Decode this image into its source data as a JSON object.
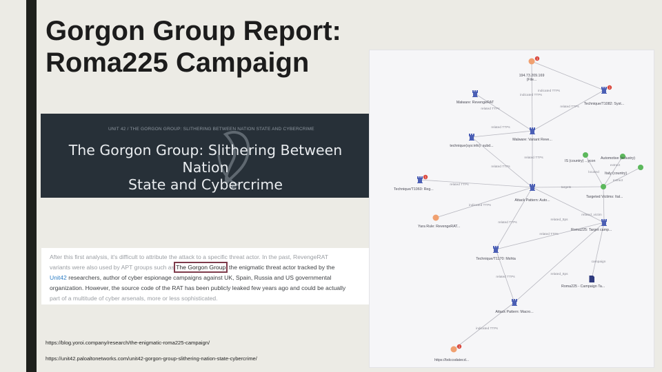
{
  "slide": {
    "title_line1": "Gorgon Group Report:",
    "title_line2": "Roma225 Campaign"
  },
  "banner": {
    "breadcrumb": "UNIT 42 / THE GORGON GROUP: SLITHERING BETWEEN NATION STATE AND CYBERCRIME",
    "title_line1": "The Gorgon Group: Slithering Between Nation",
    "title_line2": "State and Cybercrime"
  },
  "quote": {
    "line1": "After this first analysis, it's difficult to attribute the attack to a specific threat actor. In the past, RevengeRAT",
    "line2a": "variants were also used by APT groups such as",
    "line2_highlight": "The Gorgon Group",
    "line2b": ", the enigmatic threat actor tracked by the",
    "line3_link": "Unit42",
    "line3": " researchers, author of cyber espionage campaigns against UK, Spain, Russia and US governmental",
    "line4": "organization. However, the source code of the RAT has been publicly leaked few years ago and could be actually",
    "line5": "part of a multitude of cyber arsenals, more or less sophisticated."
  },
  "urls": {
    "url1": "https://blog.yoroi.company/research/the-enigmatic-roma225-campaign/",
    "url2": "https://unit42.paloaltonetworks.com/unit42-gorgon-group-slithering-nation-state-cybercrime/"
  },
  "graph": {
    "colors": {
      "edge": "#b8b8c0",
      "pattern": "#4b5fb5",
      "indicator": "#f0a070",
      "identity": "#5cb85c",
      "report": "#2f3b7e",
      "badge": "#d9453a"
    },
    "nodes": [
      {
        "id": "ip",
        "kind": "indicator",
        "label": "194.73.209.169",
        "sub": "(File...",
        "badge": "1"
      },
      {
        "id": "malware",
        "kind": "pattern",
        "label": "Malware: RevengeRAT"
      },
      {
        "id": "tech1082",
        "kind": "pattern",
        "label": "Technique/T1082: Syst...",
        "badge": "1"
      },
      {
        "id": "malvariant",
        "kind": "pattern",
        "label": "Malware: Variant Reve..."
      },
      {
        "id": "techsub",
        "kind": "pattern",
        "label": "technique(sys:info): subd..."
      },
      {
        "id": "ircountry",
        "kind": "identity",
        "label": "IS (country) ...ycon"
      },
      {
        "id": "automotive",
        "kind": "identity",
        "label": "Automotive (industry)"
      },
      {
        "id": "italy",
        "kind": "identity",
        "label": "Italy (country)"
      },
      {
        "id": "tech1060",
        "kind": "pattern",
        "label": "Technique/T1060: Reg...",
        "badge": "1"
      },
      {
        "id": "attackpattern1",
        "kind": "pattern",
        "label": "Attack Pattern: Auto..."
      },
      {
        "id": "targeted",
        "kind": "identity",
        "label": "Targeted Victims: Ital..."
      },
      {
        "id": "yara",
        "kind": "indicator",
        "label": "Yara Rule: RevengeRAT..."
      },
      {
        "id": "roma225",
        "kind": "pattern",
        "label": "Roma225: Target camp..."
      },
      {
        "id": "tech1170",
        "kind": "pattern",
        "label": "Technique/T1170: Mshta"
      },
      {
        "id": "report",
        "kind": "report",
        "label": "Roma225 - Campaign Ta..."
      },
      {
        "id": "attackpattern2",
        "kind": "pattern",
        "label": "Attack Pattern: Macro..."
      },
      {
        "id": "url",
        "kind": "indicator",
        "label": "https://bdccsdatecd...",
        "badge": "1"
      }
    ],
    "edge_labels": {
      "indicated": "indicated TTPs",
      "related": "related TTPs",
      "targets": "targets",
      "located": "located",
      "extract": "extract",
      "campaign": "campaign",
      "ttps": "related_ttps",
      "victim": "related_victim",
      "ioc": "related_ioc"
    }
  }
}
